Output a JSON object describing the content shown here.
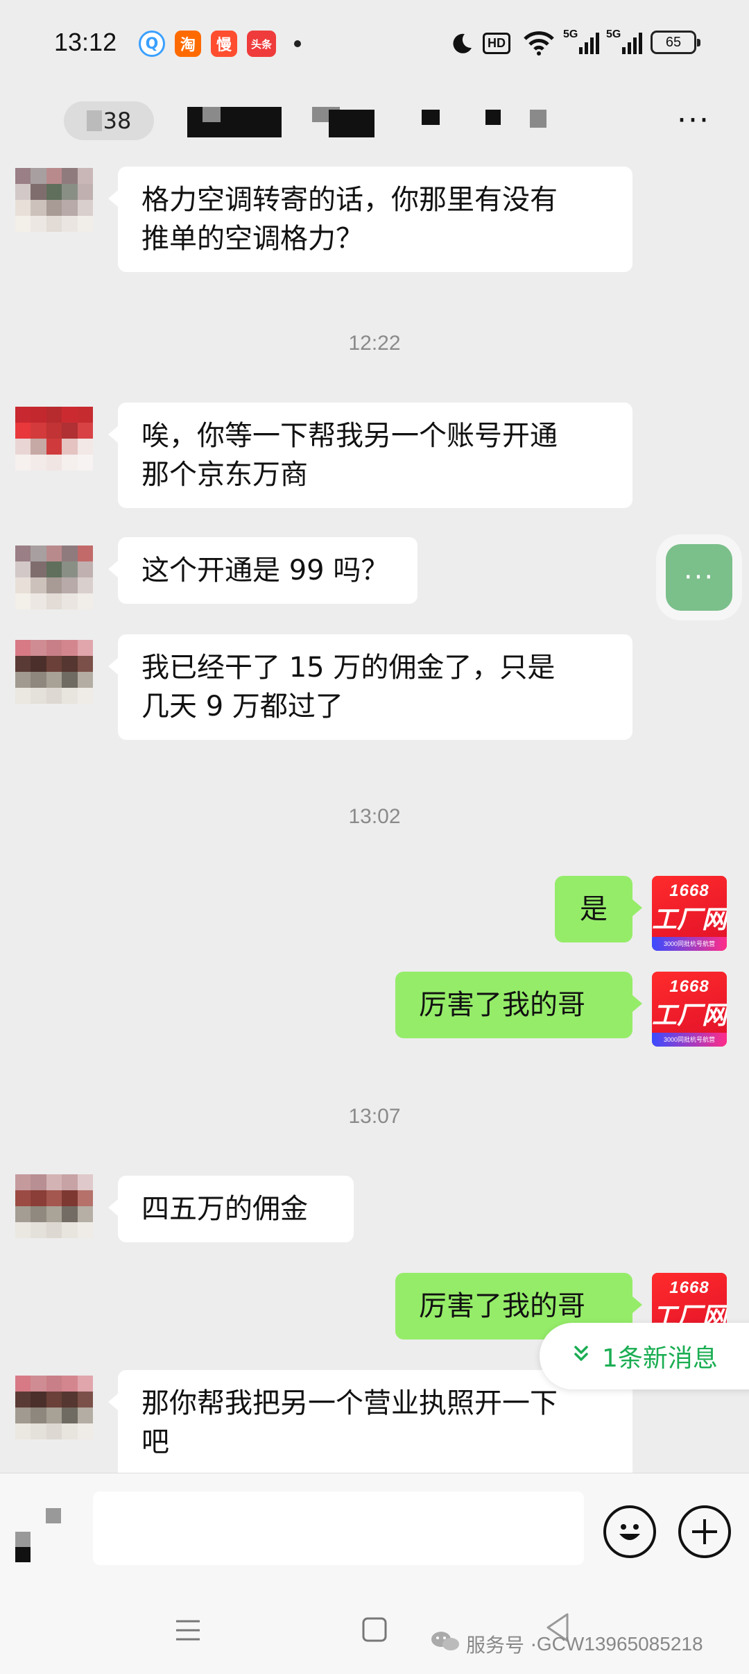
{
  "status_bar": {
    "time": "13:12",
    "apps": [
      {
        "icon": "qq-browser-icon",
        "glyph": "Q",
        "color": "#3aa0ff"
      },
      {
        "icon": "taobao-icon",
        "glyph": "淘",
        "color": "#ff6a00"
      },
      {
        "icon": "man-icon",
        "glyph": "慢",
        "color": "#ff4d30"
      },
      {
        "icon": "toutiao-icon",
        "glyph": "头条",
        "color": "#ef3b3b"
      }
    ],
    "hd": "HD",
    "net1": "5G",
    "net2": "5G",
    "battery": "65"
  },
  "header": {
    "back_text": "38",
    "more": "···"
  },
  "messages": [
    {
      "side": "left",
      "text_lines": [
        "格力空调转寄的话，你那里有没有",
        "推单的空调格力？"
      ]
    },
    {
      "timestamp": "12:22"
    },
    {
      "side": "left",
      "text_lines": [
        "唉，你等一下帮我另一个账号开通",
        "那个京东万商"
      ]
    },
    {
      "side": "left",
      "text_lines": [
        "这个开通是 99 吗？"
      ]
    },
    {
      "side": "left",
      "text_lines": [
        "我已经干了 15 万的佣金了，只是",
        "几天 9 万都过了"
      ]
    },
    {
      "timestamp": "13:02"
    },
    {
      "side": "right",
      "text_lines": [
        "是"
      ]
    },
    {
      "side": "right",
      "text_lines": [
        "厉害了我的哥"
      ]
    },
    {
      "timestamp": "13:07"
    },
    {
      "side": "left",
      "text_lines": [
        "四五万的佣金"
      ]
    },
    {
      "side": "right",
      "text_lines": [
        "厉害了我的哥"
      ]
    },
    {
      "side": "left",
      "text_lines": [
        "那你帮我把另一个营业执照开一下",
        "吧"
      ]
    }
  ],
  "self_avatar": {
    "number": "1668",
    "text": "工厂网",
    "sub": "3000同批杭号航营"
  },
  "float_button": "···",
  "new_message": "1条新消息",
  "watermark": {
    "prefix": "服务号 · ",
    "id": "GCW13965085218"
  }
}
